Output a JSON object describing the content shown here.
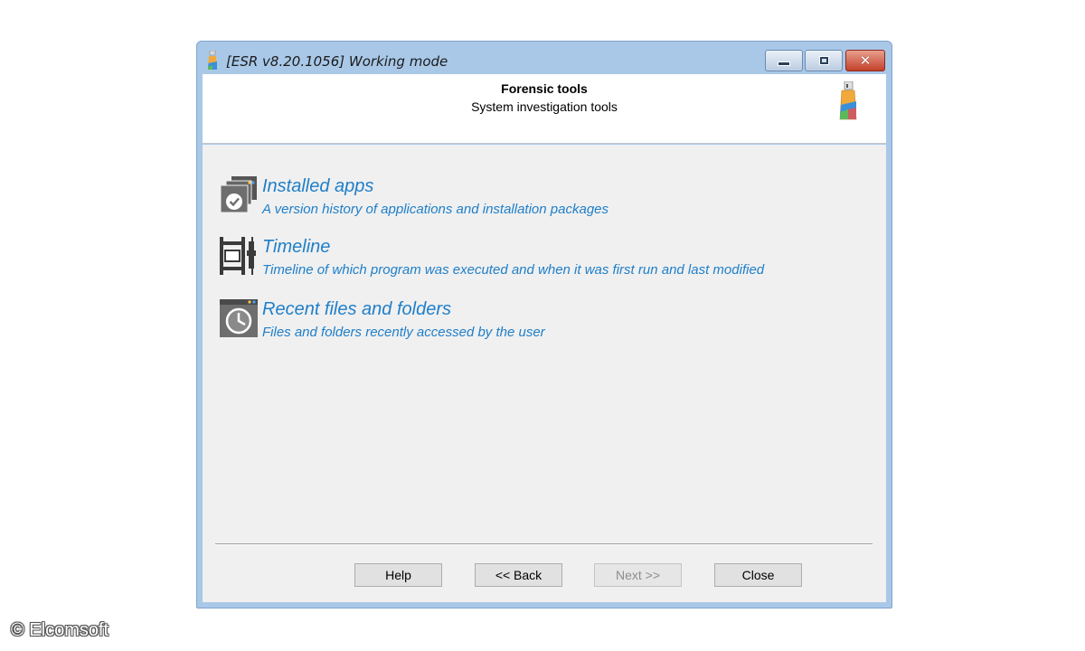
{
  "window": {
    "title": "[ESR v8.20.1056]  Working mode",
    "controls": {
      "minimize": "minimize-icon",
      "maximize": "maximize-icon",
      "close": "close-icon"
    }
  },
  "header": {
    "title": "Forensic tools",
    "subtitle": "System investigation tools",
    "logo": "esr-logo-icon"
  },
  "tools": [
    {
      "icon": "installed-apps-icon",
      "title": "Installed apps",
      "description": "A version history of applications and installation packages"
    },
    {
      "icon": "timeline-icon",
      "title": "Timeline",
      "description": "Timeline of which program was executed and when it was first run and last modified"
    },
    {
      "icon": "recent-files-icon",
      "title": "Recent files and folders",
      "description": "Files and folders recently accessed by the user"
    }
  ],
  "buttons": {
    "help": "Help",
    "back": "<< Back",
    "next": "Next >>",
    "next_enabled": false,
    "close": "Close"
  },
  "colors": {
    "link": "#1f7fc9",
    "frame": "#a9c8e8",
    "close_button": "#c4402a"
  },
  "watermark": "© Elcomsoft"
}
